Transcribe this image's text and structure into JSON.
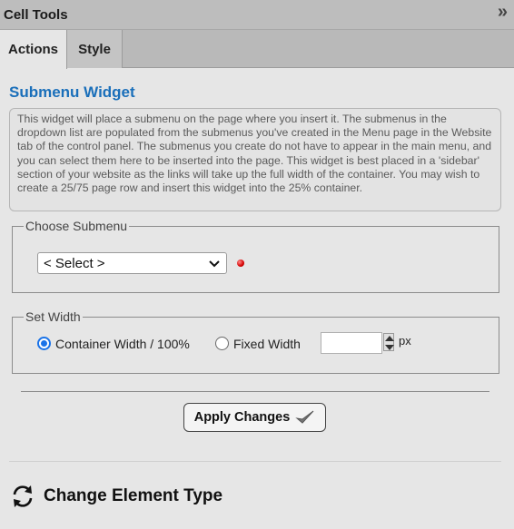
{
  "header": {
    "title": "Cell Tools",
    "collapse_glyph": "»"
  },
  "tabs": [
    {
      "label": "Actions",
      "active": true
    },
    {
      "label": "Style",
      "active": false
    }
  ],
  "widget": {
    "title": "Submenu Widget",
    "description": "This widget will place a submenu on the page where you insert it. The submenus in the dropdown list are populated from the submenus you've created in the Menu page in the Website tab of the control panel. The submenus you create do not have to appear in the main menu, and you can select them here to be inserted into the page. This widget is best placed in a 'sidebar' section of your website as the links will take up the full width of the container. You may wish to create a 25/75 page row and insert this widget into the 25% container."
  },
  "choose_submenu": {
    "legend": "Choose Submenu",
    "selected": "< Select >",
    "required_color": "#d40000"
  },
  "set_width": {
    "legend": "Set Width",
    "option_container": "Container Width / 100%",
    "option_fixed": "Fixed Width",
    "selected": "container",
    "fixed_value": "",
    "unit": "px"
  },
  "apply_button": {
    "label": "Apply Changes"
  },
  "change_type": {
    "label": "Change Element Type"
  },
  "colors": {
    "accent": "#1a6fba",
    "radio": "#1a73e8"
  }
}
